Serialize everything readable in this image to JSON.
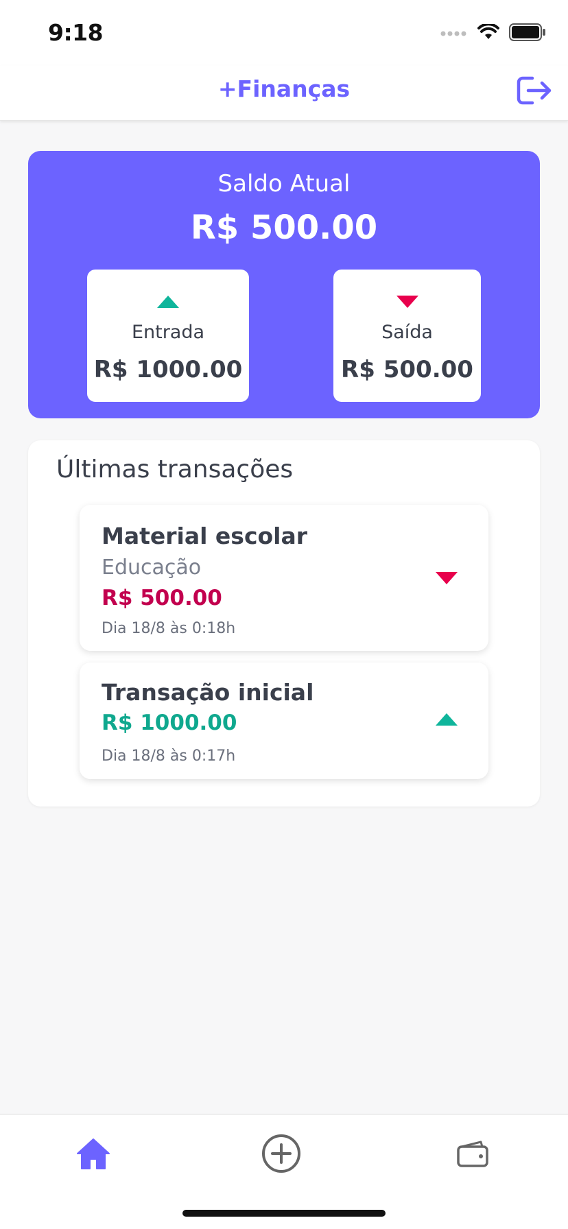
{
  "status_bar": {
    "time": "9:18"
  },
  "header": {
    "title": "+Finanças"
  },
  "balance": {
    "label": "Saldo Atual",
    "value": "R$ 500.00",
    "income": {
      "label": "Entrada",
      "value": "R$ 1000.00"
    },
    "expense": {
      "label": "Saída",
      "value": "R$ 500.00"
    }
  },
  "transactions": {
    "title": "Últimas transações",
    "items": [
      {
        "name": "Material escolar",
        "category": "Educação",
        "amount": "R$ 500.00",
        "date": "Dia 18/8 às 0:18h",
        "type": "out"
      },
      {
        "name": "Transação inicial",
        "amount": "R$ 1000.00",
        "date": "Dia 18/8 às 0:17h",
        "type": "in"
      }
    ]
  },
  "tabbar": {
    "tabs": [
      "home-icon",
      "add-circle-icon",
      "wallet-icon"
    ]
  },
  "colors": {
    "accent": "#6c63ff",
    "income": "#0fa88e",
    "expense": "#e8004c",
    "expense_text": "#c2004e"
  }
}
